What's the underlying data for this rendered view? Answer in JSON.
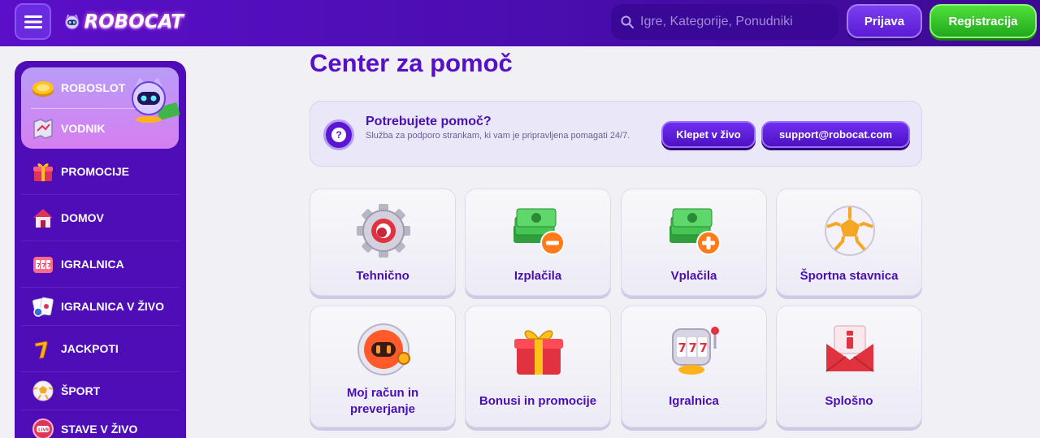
{
  "header": {
    "logo_text": "ROBOCAT",
    "search_placeholder": "Igre, Kategorije, Ponudniki",
    "login_label": "Prijava",
    "register_label": "Registracija"
  },
  "sidebar": {
    "top_items": [
      {
        "label": "ROBOSLOT",
        "icon": "coin-icon"
      },
      {
        "label": "VODNIK",
        "icon": "map-icon"
      }
    ],
    "items": [
      {
        "label": "PROMOCIJE",
        "icon": "gift-icon"
      },
      {
        "label": "DOMOV",
        "icon": "home-icon"
      },
      {
        "label": "IGRALNICA",
        "icon": "slot-icon"
      },
      {
        "label": "IGRALNICA V ŽIVO",
        "icon": "cards-icon"
      },
      {
        "label": "JACKPOTI",
        "icon": "seven-icon"
      },
      {
        "label": "ŠPORT",
        "icon": "soccer-ball-icon"
      },
      {
        "label": "STAVE V ŽIVO",
        "icon": "live-icon"
      }
    ]
  },
  "main": {
    "title": "Center za pomoč",
    "help": {
      "title": "Potrebujete pomoč?",
      "description": "Služba za podporo strankam, ki vam je pripravljena pomagati 24/7.",
      "chat_label": "Klepet v živo",
      "email_label": "support@robocat.com"
    },
    "categories": [
      {
        "label": "Tehnično",
        "icon": "gear-icon"
      },
      {
        "label": "Izplačila",
        "icon": "cash-minus-icon"
      },
      {
        "label": "Vplačila",
        "icon": "cash-plus-icon"
      },
      {
        "label": "Športna stavnica",
        "icon": "soccer-ball-icon"
      },
      {
        "label": "Moj račun in preverjanje",
        "icon": "robot-head-icon"
      },
      {
        "label": "Bonusi in promocije",
        "icon": "gift-box-icon"
      },
      {
        "label": "Igralnica",
        "icon": "slot-machine-icon"
      },
      {
        "label": "Splošno",
        "icon": "info-envelope-icon"
      }
    ]
  },
  "colors": {
    "header_bg": "#4b0db0",
    "accent": "#5710c8",
    "register_green": "#2fbf24",
    "sidebar_bg": "#4f0db8"
  }
}
